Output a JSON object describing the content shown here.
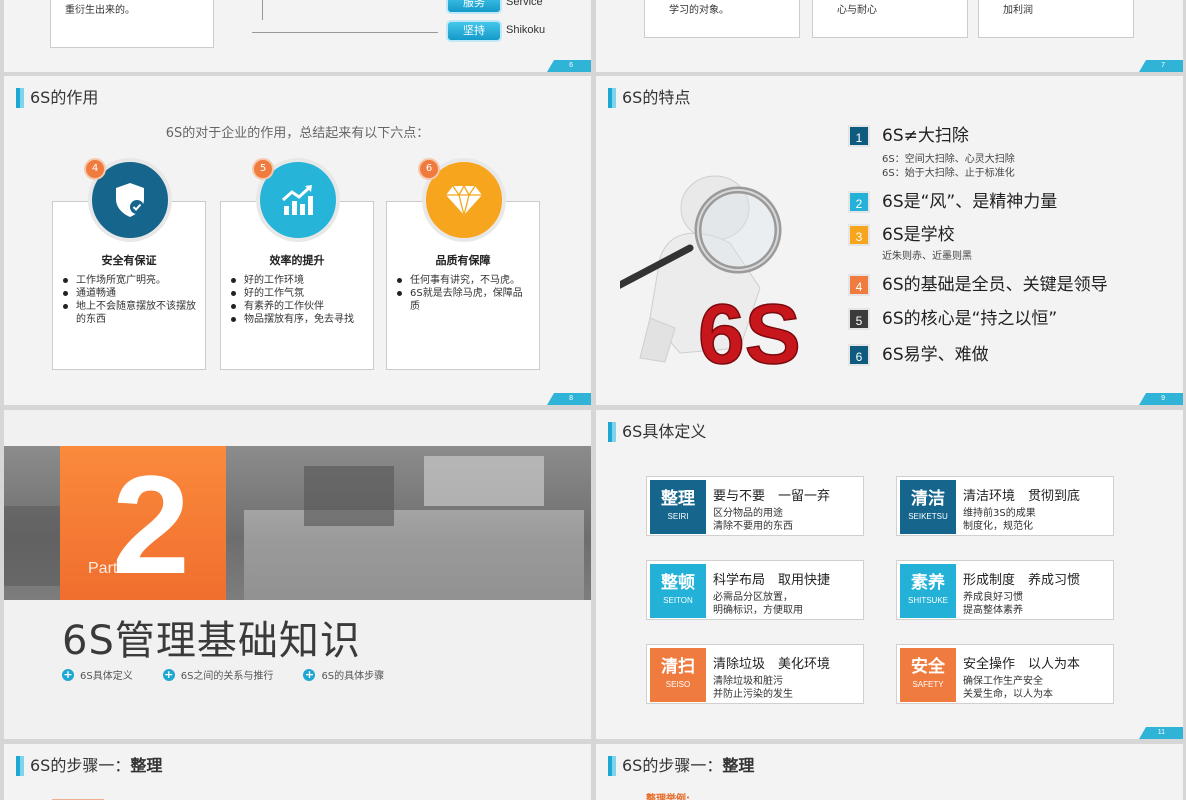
{
  "slideA": {
    "card_text": "重衍生出来的。",
    "tags": [
      {
        "label": "服务",
        "text": "Service"
      },
      {
        "label": "坚持",
        "text": "Shikoku"
      }
    ],
    "page": "6"
  },
  "slideB": {
    "cards": [
      "学习的对象。",
      "心与耐心",
      "加利润"
    ],
    "page": "7"
  },
  "s8": {
    "title": "6S的作用",
    "intro": "6S的对于企业的作用，总结起来有以下六点：",
    "page": "8",
    "boxes": [
      {
        "num": "4",
        "title": "安全有保证",
        "color": "#15658c",
        "icon": "shield-check-icon",
        "points": [
          "工作场所宽广明亮。",
          "通道畅通",
          "地上不会随意摆放不该摆放的东西"
        ]
      },
      {
        "num": "5",
        "title": "效率的提升",
        "color": "#26b4d8",
        "icon": "growth-chart-icon",
        "points": [
          "好的工作环境",
          "好的工作气氛",
          "有素养的工作伙伴",
          "物品摆放有序，免去寻找"
        ]
      },
      {
        "num": "6",
        "title": "品质有保障",
        "color": "#f6a51d",
        "icon": "diamond-icon",
        "points": [
          "任何事有讲究，不马虎。",
          "6S就是去除马虎，保障品质"
        ]
      }
    ]
  },
  "s9": {
    "title": "6S的特点",
    "page": "9",
    "logo_text": "6S",
    "items": [
      {
        "num": "1",
        "text": "6S≠大扫除",
        "color": "#0f5b80"
      },
      {
        "num": "2",
        "text": "6S是“风”、是精神力量",
        "color": "#23b1d8"
      },
      {
        "num": "3",
        "text": "6S是学校",
        "color": "#f6a51d"
      },
      {
        "num": "4",
        "text": "6S的基础是全员、关键是领导",
        "color": "#f07b3f"
      },
      {
        "num": "5",
        "text": "6S的核心是“持之以恒”",
        "color": "#3b3b3b"
      },
      {
        "num": "6",
        "text": "6S易学、难做",
        "color": "#0f5b80"
      }
    ],
    "sub1a": "6S：空间大扫除、心灵大扫除",
    "sub1b": "6S：始于大扫除、止于标准化",
    "sub3": "近朱则赤、近墨则黑"
  },
  "s10": {
    "part_num": "2",
    "part_label": "Part",
    "title": "6S管理基础知识",
    "links": [
      "6S具体定义",
      "6S之间的关系与推行",
      "6S的具体步骤"
    ]
  },
  "s11": {
    "title": "6S具体定义",
    "page": "11",
    "cards": [
      {
        "cn": "整理",
        "en": "SEIRI",
        "color": "#15658c",
        "head": "要与不要　一留一弃",
        "d1": "区分物品的用途",
        "d2": "清除不要用的东西"
      },
      {
        "cn": "清洁",
        "en": "SEIKETSU",
        "color": "#15658c",
        "head": "清洁环境　贯彻到底",
        "d1": "维持前3S的成果",
        "d2": "制度化，规范化"
      },
      {
        "cn": "整顿",
        "en": "SEITON",
        "color": "#23b1d8",
        "head": "科学布局　取用快捷",
        "d1": "必需品分区放置，",
        "d2": "明确标识，方便取用"
      },
      {
        "cn": "素养",
        "en": "SHITSUKE",
        "color": "#23b1d8",
        "head": "形成制度　养成习惯",
        "d1": "养成良好习惯",
        "d2": "提高整体素养"
      },
      {
        "cn": "清扫",
        "en": "SEISO",
        "color": "#f07b3f",
        "head": "清除垃圾　美化环境",
        "d1": "清除垃圾和脏污",
        "d2": "并防止污染的发生"
      },
      {
        "cn": "安全",
        "en": "SAFETY",
        "color": "#f07b3f",
        "head": "安全操作　以人为本",
        "d1": "确保工作生产安全",
        "d2": "关爱生命，以人为本"
      }
    ]
  },
  "s12": {
    "title_prefix": "6S的步骤一：",
    "title_bold": "整理"
  },
  "s13": {
    "title_prefix": "6S的步骤一：",
    "title_bold": "整理",
    "example": "整理举例:"
  }
}
